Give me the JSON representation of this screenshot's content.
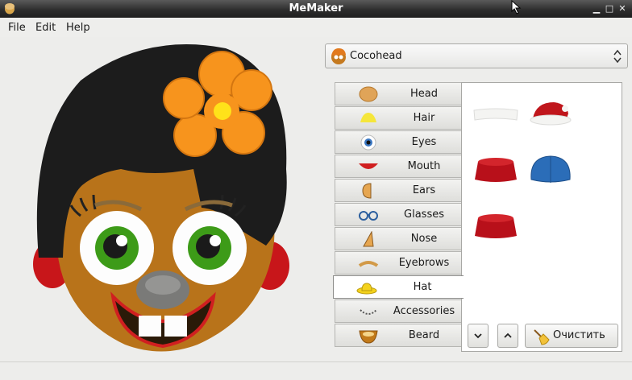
{
  "window": {
    "title": "MeMaker"
  },
  "menu": [
    {
      "label": "File"
    },
    {
      "label": "Edit"
    },
    {
      "label": "Help"
    }
  ],
  "face_selector": {
    "selected": "Cocohead"
  },
  "categories": [
    {
      "label": "Head",
      "icon": "head-icon"
    },
    {
      "label": "Hair",
      "icon": "hair-icon"
    },
    {
      "label": "Eyes",
      "icon": "eye-icon"
    },
    {
      "label": "Mouth",
      "icon": "mouth-icon"
    },
    {
      "label": "Ears",
      "icon": "ear-icon"
    },
    {
      "label": "Glasses",
      "icon": "glasses-icon"
    },
    {
      "label": "Nose",
      "icon": "nose-icon"
    },
    {
      "label": "Eyebrows",
      "icon": "eyebrow-icon"
    },
    {
      "label": "Hat",
      "icon": "hat-icon",
      "selected": true
    },
    {
      "label": "Accessories",
      "icon": "accessories-icon"
    },
    {
      "label": "Beard",
      "icon": "beard-icon"
    }
  ],
  "hat_options": [
    {
      "name": "white-band-hat",
      "color": "#f2f2f0"
    },
    {
      "name": "santa-hat",
      "color": "#c0161c"
    },
    {
      "name": "red-fez-hat",
      "color": "#b8101a"
    },
    {
      "name": "blue-cap-hat",
      "color": "#2b6db8"
    },
    {
      "name": "red-fez-hat-2",
      "color": "#b8101a"
    }
  ],
  "controls": {
    "clear_label": "Очистить"
  },
  "colors": {
    "flower": "#f7941d",
    "hair": "#1c1c1c",
    "skin": "#c07a14",
    "iris": "#3d9b18",
    "lips": "#d01f20"
  }
}
